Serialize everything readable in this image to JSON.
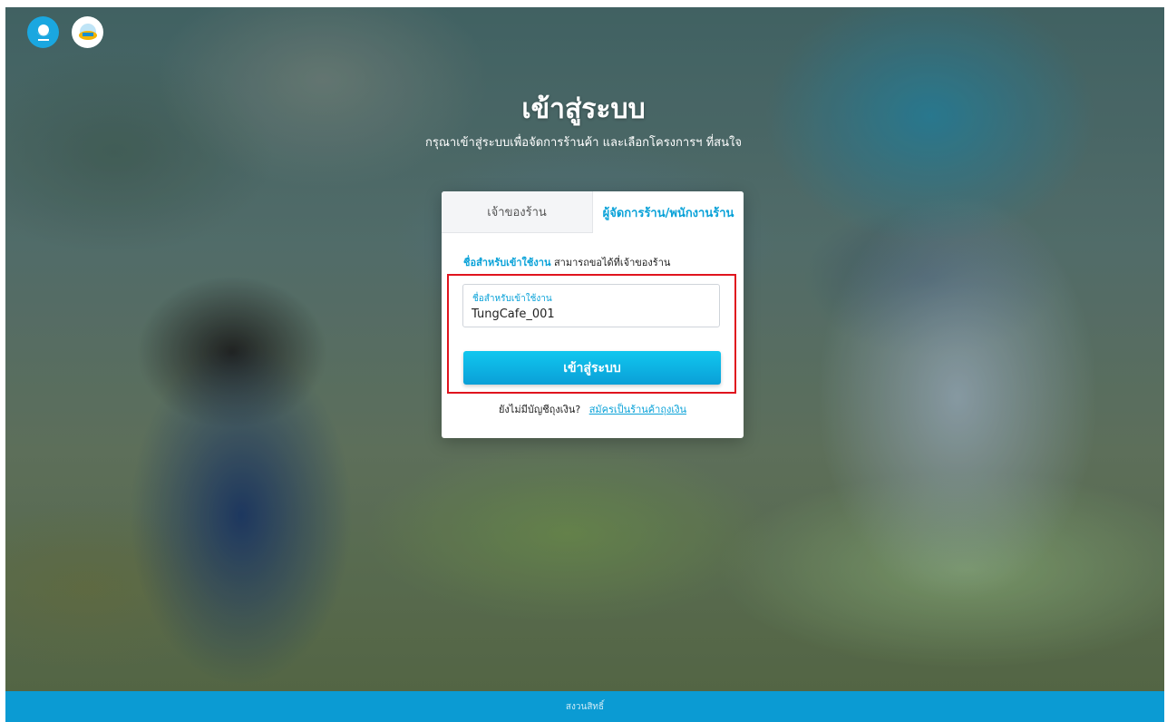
{
  "header": {
    "title": "เข้าสู่ระบบ",
    "subtitle": "กรุณาเข้าสู่ระบบเพื่อจัดการร้านค้า และเลือกโครงการฯ ที่สนใจ",
    "logos": [
      {
        "name": "krungthai-logo"
      },
      {
        "name": "tungngern-logo"
      }
    ]
  },
  "tabs": [
    {
      "label": "เจ้าของร้าน",
      "active": false
    },
    {
      "label": "ผู้จัดการร้าน/พนักงานร้าน",
      "active": true
    }
  ],
  "form": {
    "hint_link": "ชื่อสำหรับเข้าใช้งาน",
    "hint_text": "สามารถขอได้ที่เจ้าของร้าน",
    "username_label": "ชื่อสำหรับเข้าใช้งาน",
    "username_value": "TungCafe_001",
    "submit_label": "เข้าสู่ระบบ"
  },
  "signup": {
    "question": "ยังไม่มีบัญชีถุงเงิน?",
    "link": "สมัครเป็นร้านค้าถุงเงิน"
  },
  "footer": {
    "text": "สงวนสิทธิ์"
  },
  "colors": {
    "accent": "#0aa2d8",
    "footer_bg": "#0b9bd3",
    "highlight": "#e0141e"
  }
}
